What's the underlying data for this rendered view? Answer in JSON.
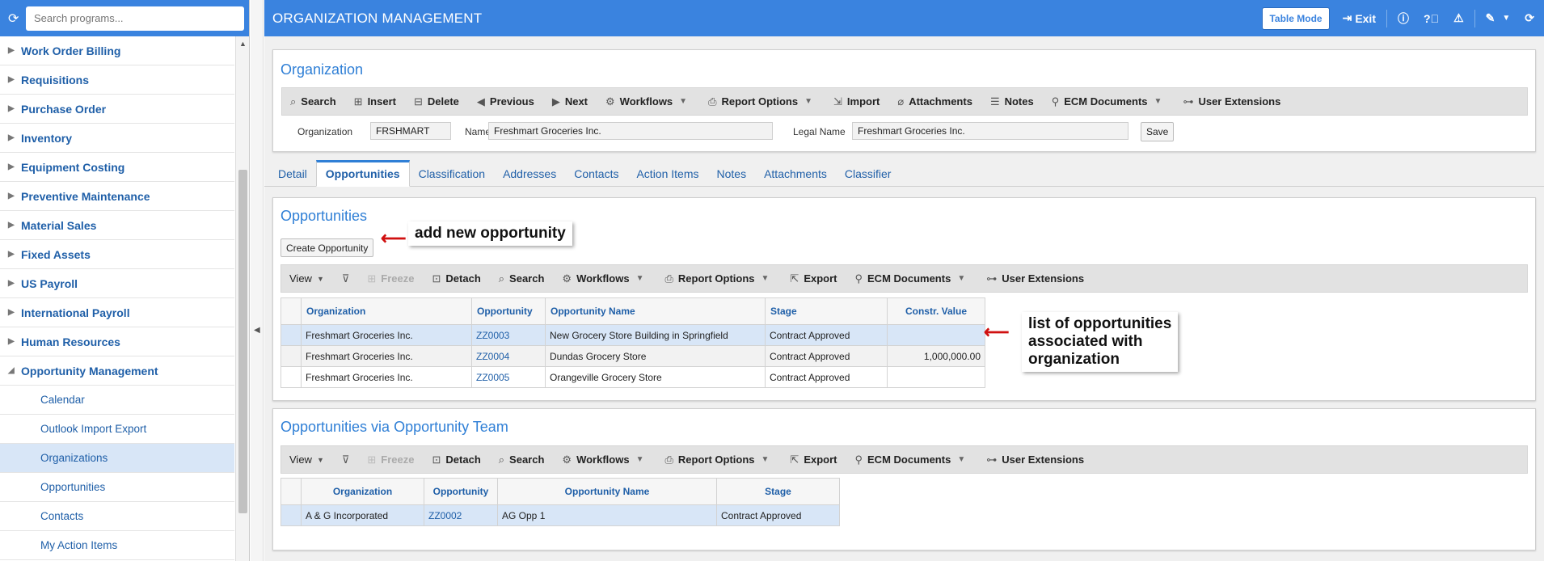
{
  "sidebar": {
    "search_placeholder": "Search programs...",
    "items": [
      {
        "label": "Work Order Billing",
        "expanded": false
      },
      {
        "label": "Requisitions",
        "expanded": false
      },
      {
        "label": "Purchase Order",
        "expanded": false
      },
      {
        "label": "Inventory",
        "expanded": false
      },
      {
        "label": "Equipment Costing",
        "expanded": false
      },
      {
        "label": "Preventive Maintenance",
        "expanded": false
      },
      {
        "label": "Material Sales",
        "expanded": false
      },
      {
        "label": "Fixed Assets",
        "expanded": false
      },
      {
        "label": "US Payroll",
        "expanded": false
      },
      {
        "label": "International Payroll",
        "expanded": false
      },
      {
        "label": "Human Resources",
        "expanded": false
      },
      {
        "label": "Opportunity Management",
        "expanded": true
      }
    ],
    "subitems": [
      "Calendar",
      "Outlook Import Export",
      "Organizations",
      "Opportunities",
      "Contacts",
      "My Action Items"
    ],
    "selected_subitem": "Organizations"
  },
  "header": {
    "title": "ORGANIZATION MANAGEMENT",
    "table_mode": "Table Mode",
    "exit": "Exit"
  },
  "org_panel": {
    "title": "Organization",
    "toolbar": [
      "Search",
      "Insert",
      "Delete",
      "Previous",
      "Next",
      "Workflows",
      "Report Options",
      "Import",
      "Attachments",
      "Notes",
      "ECM Documents",
      "User Extensions"
    ],
    "org_label": "Organization",
    "org_value": "FRSHMART",
    "name_label": "Name",
    "name_value": "Freshmart Groceries Inc.",
    "legal_label": "Legal Name",
    "legal_value": "Freshmart Groceries Inc.",
    "save": "Save"
  },
  "tabs": [
    "Detail",
    "Opportunities",
    "Classification",
    "Addresses",
    "Contacts",
    "Action Items",
    "Notes",
    "Attachments",
    "Classifier"
  ],
  "active_tab": "Opportunities",
  "opps_panel": {
    "title": "Opportunities",
    "create_button": "Create Opportunity",
    "toolbar": [
      "View",
      "Freeze",
      "Detach",
      "Search",
      "Workflows",
      "Report Options",
      "Export",
      "ECM Documents",
      "User Extensions"
    ],
    "columns": [
      "Organization",
      "Opportunity",
      "Opportunity Name",
      "Stage",
      "Constr. Value"
    ],
    "rows": [
      [
        "Freshmart Groceries Inc.",
        "ZZ0003",
        "New Grocery Store Building in Springfield",
        "Contract Approved",
        ""
      ],
      [
        "Freshmart Groceries Inc.",
        "ZZ0004",
        "Dundas Grocery Store",
        "Contract Approved",
        "1,000,000.00"
      ],
      [
        "Freshmart Groceries Inc.",
        "ZZ0005",
        "Orangeville Grocery Store",
        "Contract Approved",
        ""
      ]
    ]
  },
  "team_panel": {
    "title": "Opportunities via Opportunity Team",
    "toolbar": [
      "View",
      "Freeze",
      "Detach",
      "Search",
      "Workflows",
      "Report Options",
      "Export",
      "ECM Documents",
      "User Extensions"
    ],
    "columns": [
      "Organization",
      "Opportunity",
      "Opportunity Name",
      "Stage"
    ],
    "rows": [
      [
        "A & G Incorporated",
        "ZZ0002",
        "AG Opp 1",
        "Contract Approved"
      ]
    ]
  },
  "callouts": {
    "add_new": "add new opportunity",
    "list_line1": "list of opportunities",
    "list_line2": "associated with",
    "list_line3": "organization"
  }
}
